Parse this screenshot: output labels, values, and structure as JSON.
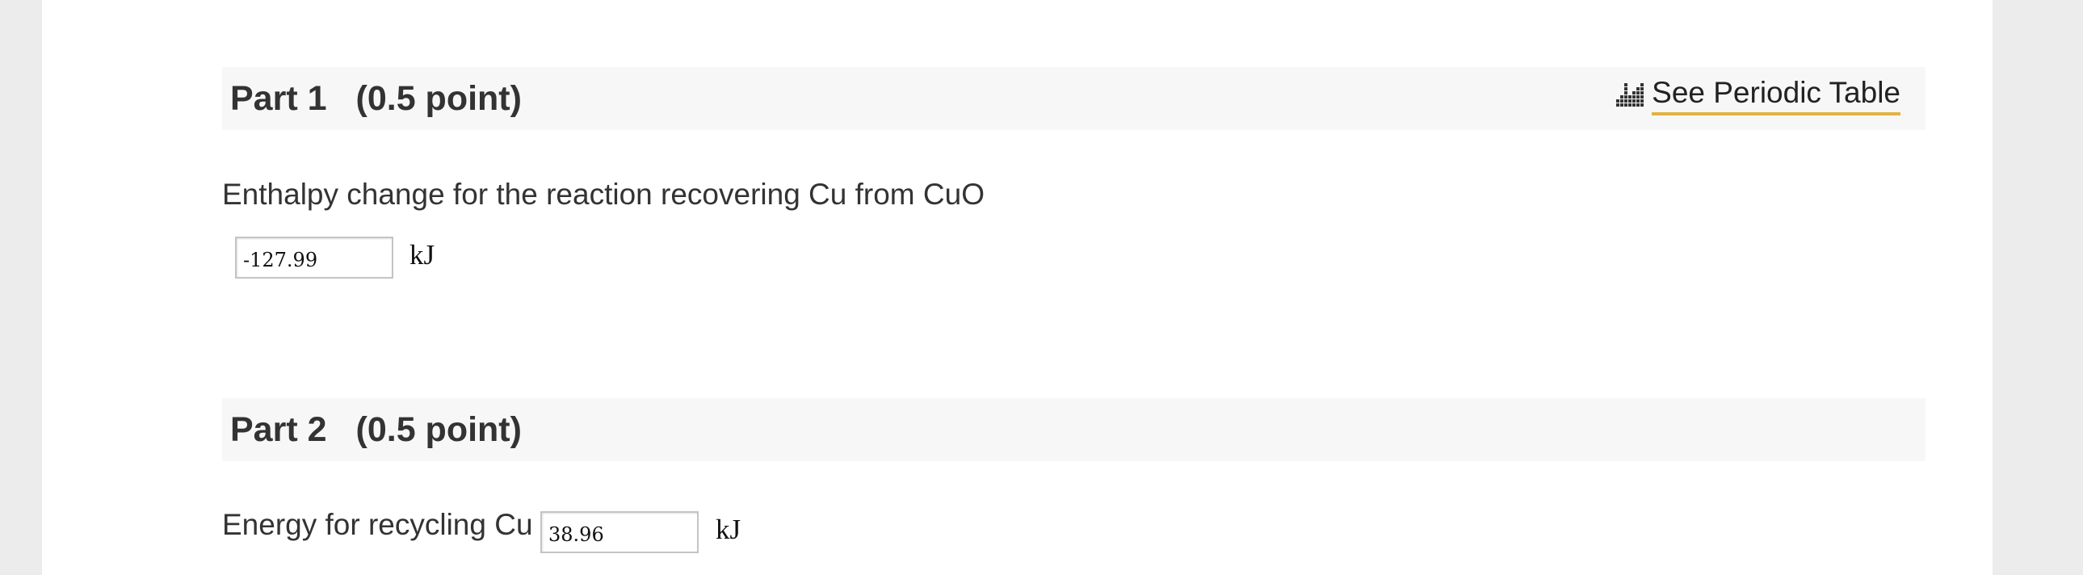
{
  "part1": {
    "title": "Part 1",
    "points": "(0.5 point)",
    "periodic_table_link": "See Periodic Table",
    "periodic_icon": "periodic-table-icon",
    "question": "Enthalpy change for the reaction recovering Cu from CuO",
    "answer_value": "-127.99",
    "unit": "kJ"
  },
  "part2": {
    "title": "Part 2",
    "points": "(0.5 point)",
    "question": "Energy for recycling Cu",
    "answer_value": "38.96",
    "unit": "kJ"
  },
  "colors": {
    "page_background": "#ececec",
    "content_background": "#ffffff",
    "header_background": "#f7f7f7",
    "link_underline": "#e3b341"
  }
}
